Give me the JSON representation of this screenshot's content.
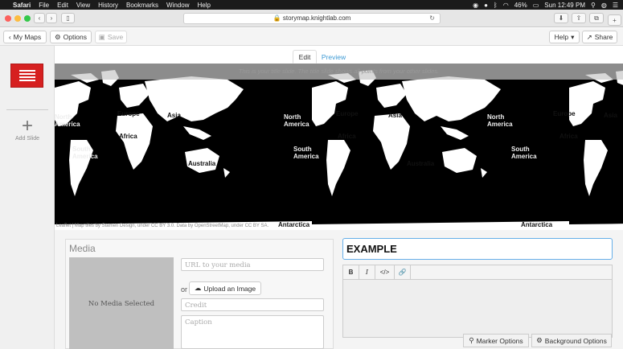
{
  "menubar": {
    "app": "Safari",
    "items": [
      "File",
      "Edit",
      "View",
      "History",
      "Bookmarks",
      "Window",
      "Help"
    ],
    "battery": "46%",
    "clock": "Sun 12:49 PM"
  },
  "browser": {
    "url": "storymap.knightlab.com"
  },
  "toolbar": {
    "my_maps": "My Maps",
    "options": "Options",
    "save": "Save",
    "help": "Help",
    "share": "Share"
  },
  "sidebar": {
    "add_slide": "Add Slide"
  },
  "tabs": {
    "edit": "Edit",
    "preview": "Preview"
  },
  "map": {
    "notice": "This is your title slide. The title slide shows all points from your other slides.",
    "attribution": "Leaflet | Map tiles by Stamen Design, under CC BY 3.0. Data by OpenStreetMap, under CC BY SA.",
    "labels": {
      "north": "North",
      "america": "America",
      "europe": "Europe",
      "asia": "Asia",
      "africa": "Africa",
      "south": "South",
      "australia": "Australia",
      "antarctica": "Antarctica"
    }
  },
  "media": {
    "title": "Media",
    "no_media": "No Media Selected",
    "url_placeholder": "URL to your media",
    "or": "or",
    "upload": "Upload an Image",
    "credit_placeholder": "Credit",
    "caption_placeholder": "Caption"
  },
  "editor": {
    "headline": "EXAMPLE",
    "bold": "B",
    "italic": "I",
    "code": "</>",
    "link": "🔗"
  },
  "options": {
    "marker": "Marker Options",
    "background": "Background Options"
  },
  "colors": {
    "accent_red": "#d62020",
    "link_blue": "#3b99d4",
    "focus_blue": "#66afe9"
  }
}
